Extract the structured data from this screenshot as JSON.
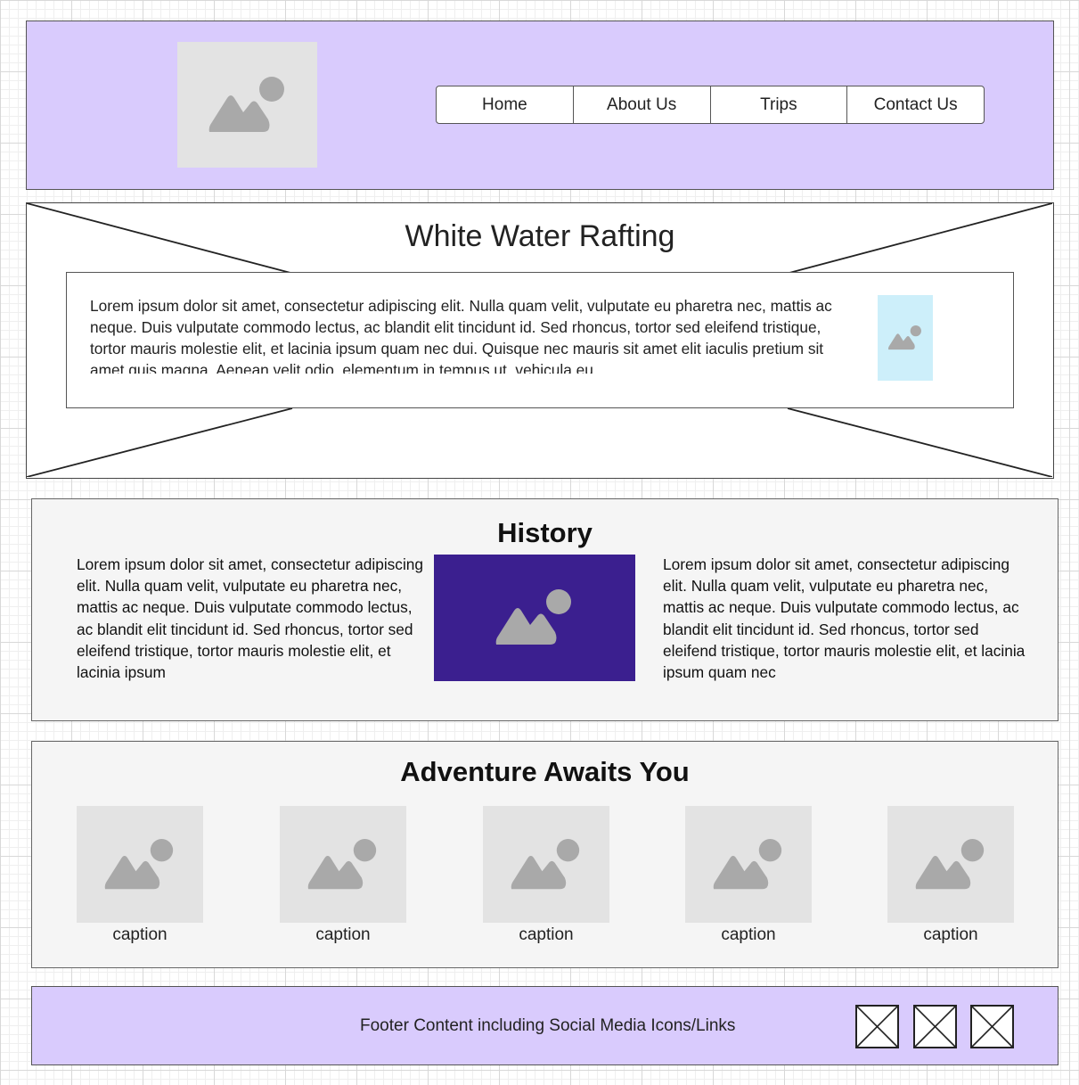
{
  "header": {
    "logo_icon": "image-placeholder-icon",
    "nav": [
      "Home",
      "About Us",
      "Trips",
      "Contact Us"
    ]
  },
  "hero": {
    "title": "White Water Rafting",
    "text": "Lorem ipsum dolor sit amet, consectetur adipiscing elit. Nulla quam velit, vulputate eu pharetra nec, mattis ac neque. Duis vulputate commodo lectus, ac blandit elit tincidunt id. Sed rhoncus, tortor sed eleifend tristique, tortor mauris molestie elit, et lacinia ipsum quam nec dui. Quisque nec mauris sit amet elit iaculis pretium sit amet quis magna. Aenean velit odio, elementum in tempus ut, vehicula eu"
  },
  "history": {
    "title": "History",
    "left_text": "Lorem ipsum dolor sit amet, consectetur adipiscing elit. Nulla quam velit, vulputate eu pharetra nec, mattis ac neque. Duis vulputate commodo lectus, ac blandit elit tincidunt id. Sed rhoncus, tortor sed eleifend tristique, tortor mauris molestie elit, et lacinia ipsum",
    "right_text": "Lorem ipsum dolor sit amet, consectetur adipiscing elit. Nulla quam velit, vulputate eu pharetra nec, mattis ac neque. Duis vulputate commodo lectus, ac blandit elit tincidunt id. Sed rhoncus, tortor sed eleifend tristique, tortor mauris molestie elit, et lacinia ipsum quam nec"
  },
  "adventure": {
    "title": "Adventure Awaits You",
    "captions": [
      "caption",
      "caption",
      "caption",
      "caption",
      "caption"
    ]
  },
  "footer": {
    "text": "Footer Content including Social Media Icons/Links",
    "social_icon": "image-placeholder-x-icon"
  },
  "colors": {
    "header_bg": "#d9cbfd",
    "hero_thumb_bg": "#cdeffa",
    "history_img_bg": "#3b1f8f",
    "placeholder_bg": "#e3e3e3"
  }
}
